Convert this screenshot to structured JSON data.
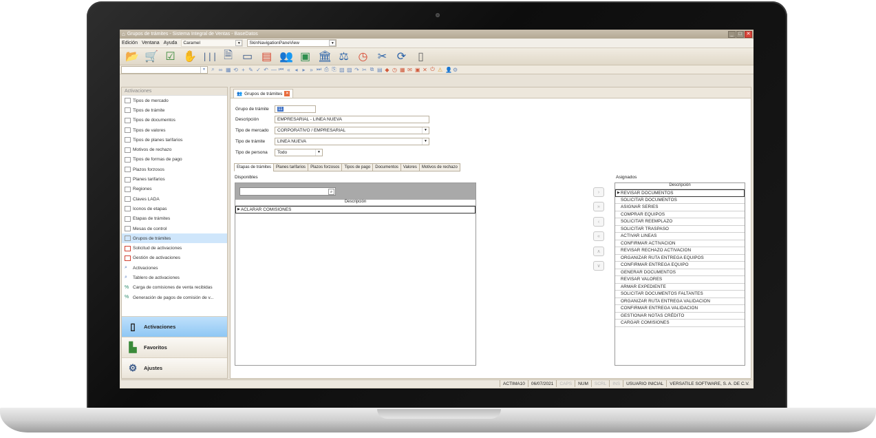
{
  "window": {
    "title": "Grupos de trámites - Sistema Integral de Ventas - BaseDatos"
  },
  "menu": {
    "items": [
      "Edición",
      "Ventana",
      "Ayuda"
    ],
    "skin": "Caramel",
    "nav_view": "SkinNavigationPaneView"
  },
  "toolbar_icons": [
    "folder-icon",
    "cart-icon",
    "checklist-icon",
    "hand-icon",
    "barcode-icon",
    "document-icon",
    "id-card-icon",
    "report-icon",
    "users-icon",
    "money-icon",
    "bank-icon",
    "scale-icon",
    "clock-icon",
    "tools-icon",
    "refresh-icon",
    "mobile-icon"
  ],
  "sidebar": {
    "header": "Activaciones",
    "items": [
      {
        "label": "Tipos de mercado",
        "type": "grid"
      },
      {
        "label": "Tipos de trámite",
        "type": "grid"
      },
      {
        "label": "Tipos de documentos",
        "type": "grid"
      },
      {
        "label": "Tipos de valores",
        "type": "grid"
      },
      {
        "label": "Tipos de planes tarifarios",
        "type": "grid"
      },
      {
        "label": "Motivos de rechazo",
        "type": "grid"
      },
      {
        "label": "Tipos de formas de pago",
        "type": "grid"
      },
      {
        "label": "Plazos forzosos",
        "type": "grid"
      },
      {
        "label": "Planes tarifarios",
        "type": "grid"
      },
      {
        "label": "Regiones",
        "type": "grid"
      },
      {
        "label": "Claves LADA",
        "type": "grid"
      },
      {
        "label": "Iconos de etapas",
        "type": "grid"
      },
      {
        "label": "Etapas de trámites",
        "type": "grid"
      },
      {
        "label": "Mesas de control",
        "type": "grid"
      },
      {
        "label": "Grupos de trámites",
        "type": "grid",
        "selected": true
      },
      {
        "label": "Solicitud de activaciones",
        "type": "doc"
      },
      {
        "label": "Gestión de activaciones",
        "type": "doc"
      },
      {
        "label": "Activaciones",
        "type": "search"
      },
      {
        "label": "Tablero de activaciones",
        "type": "search"
      },
      {
        "label": "Carga de comisiones de venta recibidas",
        "type": "pct"
      },
      {
        "label": "Generación de pagos de comisión de v...",
        "type": "pct"
      }
    ],
    "nav_buttons": [
      {
        "label": "Activaciones",
        "icon": "mobile-icon"
      },
      {
        "label": "Favoritos",
        "icon": "blocks-icon"
      },
      {
        "label": "Ajustes",
        "icon": "gears-icon"
      }
    ]
  },
  "doc_tab": {
    "label": "Grupos de trámites"
  },
  "form": {
    "grupo_label": "Grupo de trámite",
    "grupo_value": "11",
    "descripcion_label": "Descripción",
    "descripcion_value": "EMPRESARIAL - LINEA NUEVA",
    "mercado_label": "Tipo de mercado",
    "mercado_value": "CORPORATIVO / EMPRESARIAL",
    "tramite_label": "Tipo de trámite",
    "tramite_value": "LINEA NUEVA",
    "persona_label": "Tipo de persona",
    "persona_value": "Todo"
  },
  "panel_tabs": [
    "Etapas de trámites",
    "Planes tarifarios",
    "Plazos forzosos",
    "Tipos de pago",
    "Documentos",
    "Valores",
    "Motivos de rechazo"
  ],
  "disponibles": {
    "title": "Disponibles",
    "column": "Descripción",
    "rows": [
      "ACLARAR COMISIONES"
    ]
  },
  "asignados": {
    "title": "Asignados",
    "column": "Descripción",
    "rows": [
      "REVISAR DOCUMENTOS",
      "SOLICITAR DOCUMENTOS",
      "ASIGNAR SERIES",
      "COMPRAR EQUIPOS",
      "SOLICITAR REEMPLAZO",
      "SOLICITAR TRASPASO",
      "ACTIVAR LINEAS",
      "CONFIRMAR ACTIVACION",
      "REVISAR RECHAZO ACTIVACION",
      "ORGANIZAR RUTA ENTREGA EQUIPOS",
      "CONFIRMAR ENTREGA EQUIPO",
      "GENERAR DOCUMENTOS",
      "REVISAR VALORES",
      "ARMAR EXPEDIENTE",
      "SOLICITAR DOCUMENTOS FALTANTES",
      "ORGANIZAR RUTA ENTREGA VALIDACION",
      "CONFIRMAR ENTREGA VALIDACION",
      "GESTIONAR NOTAS CRÉDITO",
      "CARGAR COMISIONES"
    ]
  },
  "statusbar": {
    "station": "ACTIMA10",
    "date": "06/07/2021",
    "caps": "CAPS",
    "num": "NUM",
    "scrl": "SCRL",
    "ins": "INS",
    "user": "USUARIO INICIAL",
    "company": "VERSATILE SOFTWARE, S. A. DE C.V."
  }
}
